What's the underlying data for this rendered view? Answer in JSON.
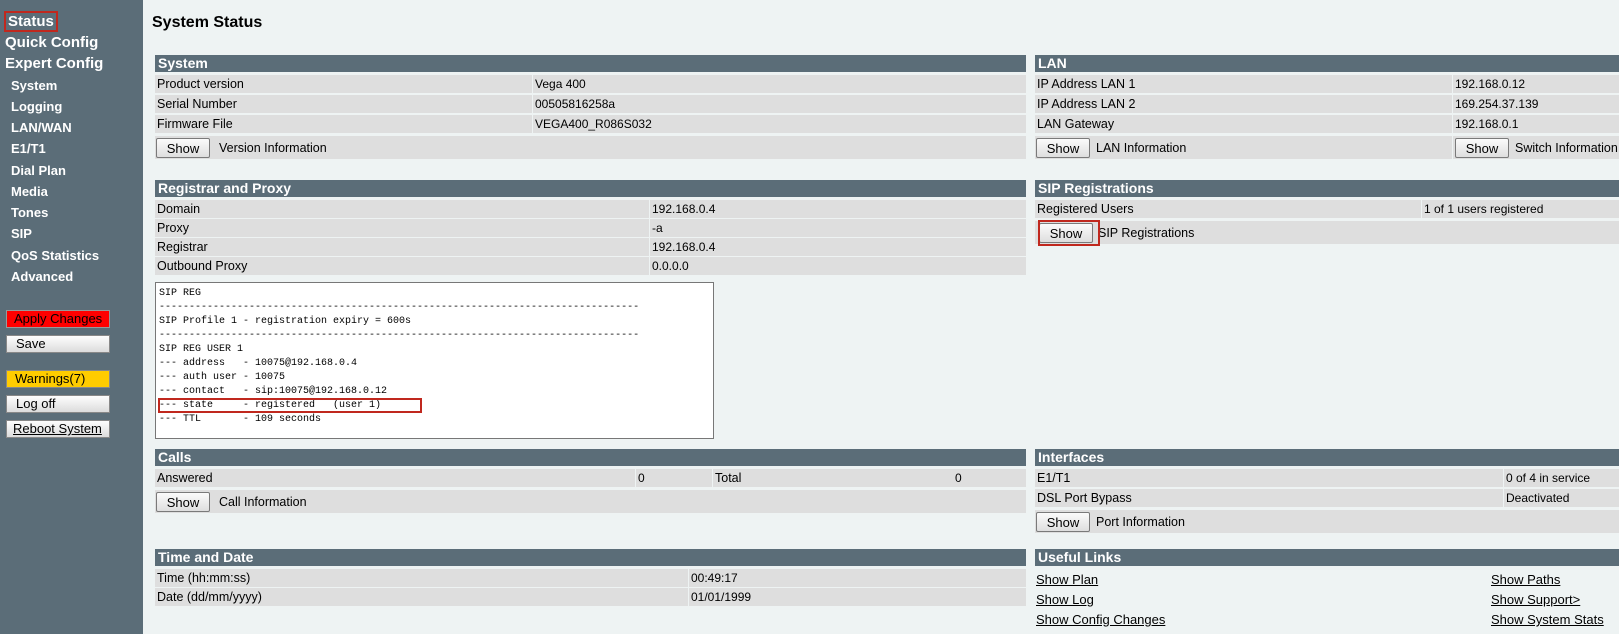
{
  "sidebar": {
    "status": "Status",
    "quick_config": "Quick Config",
    "expert_config": "Expert Config",
    "items": [
      "System",
      "Logging",
      "LAN/WAN",
      "E1/T1",
      "Dial Plan",
      "Media",
      "Tones",
      "SIP",
      "QoS Statistics",
      "Advanced"
    ],
    "apply_changes": "Apply Changes",
    "save": "Save",
    "warnings": "Warnings(7)",
    "log_off": "Log off",
    "reboot_system": "Reboot System"
  },
  "page": {
    "title": "System Status"
  },
  "system": {
    "header": "System",
    "rows": [
      {
        "label": "Product version",
        "value": "Vega 400"
      },
      {
        "label": "Serial Number",
        "value": "00505816258a"
      },
      {
        "label": "Firmware File",
        "value": "VEGA400_R086S032"
      }
    ],
    "button": "Show",
    "button_caption": "Version Information"
  },
  "lan": {
    "header": "LAN",
    "rows": [
      {
        "label": "IP Address LAN 1",
        "value": "192.168.0.12"
      },
      {
        "label": "IP Address LAN 2",
        "value": "169.254.37.139"
      },
      {
        "label": "LAN Gateway",
        "value": "192.168.0.1"
      }
    ],
    "button": "Show",
    "button_caption": "LAN Information",
    "button2": "Show",
    "button2_caption": "Switch Information"
  },
  "registrar": {
    "header": "Registrar and Proxy",
    "rows": [
      {
        "label": "Domain",
        "value": "192.168.0.4"
      },
      {
        "label": "Proxy",
        "value": "-a"
      },
      {
        "label": "Registrar",
        "value": "192.168.0.4"
      },
      {
        "label": "Outbound Proxy",
        "value": "0.0.0.0"
      }
    ]
  },
  "sip_reg_output": "SIP REG\n--------------------------------------------------------------------------------\nSIP Profile 1 - registration expiry = 600s\n--------------------------------------------------------------------------------\nSIP REG USER 1\n--- address   - 10075@192.168.0.4\n--- auth user - 10075\n--- contact   - sip:10075@192.168.0.12\n--- state     - registered   (user 1)\n--- TTL       - 109 seconds",
  "sip_registrations": {
    "header": "SIP Registrations",
    "label": "Registered Users",
    "value": "1 of 1 users registered",
    "button": "Show",
    "button_caption": "SIP Registrations"
  },
  "calls": {
    "header": "Calls",
    "answered_label": "Answered",
    "answered_value": "0",
    "total_label": "Total",
    "total_value": "0",
    "button": "Show",
    "button_caption": "Call Information"
  },
  "interfaces": {
    "header": "Interfaces",
    "rows": [
      {
        "label": "E1/T1",
        "value": "0 of 4 in service"
      },
      {
        "label": "DSL Port Bypass",
        "value": "Deactivated"
      }
    ],
    "button": "Show",
    "button_caption": "Port Information"
  },
  "time_date": {
    "header": "Time and Date",
    "rows": [
      {
        "label": "Time (hh:mm:ss)",
        "value": "00:49:17"
      },
      {
        "label": "Date (dd/mm/yyyy)",
        "value": "01/01/1999"
      }
    ]
  },
  "useful_links": {
    "header": "Useful Links",
    "left": [
      "Show Plan",
      "Show Log",
      "Show Config Changes"
    ],
    "right": [
      "Show Paths",
      "Show Support>",
      "Show System Stats"
    ]
  },
  "colors": {
    "sidebar_bg": "#5b6d78",
    "header_bg": "#5b6d78",
    "page_bg": "#eef3f3",
    "cell_bg": "#dedede",
    "apply_button": "#ff0000",
    "warnings_button": "#ffcc00",
    "highlight_border": "#c0281e"
  }
}
